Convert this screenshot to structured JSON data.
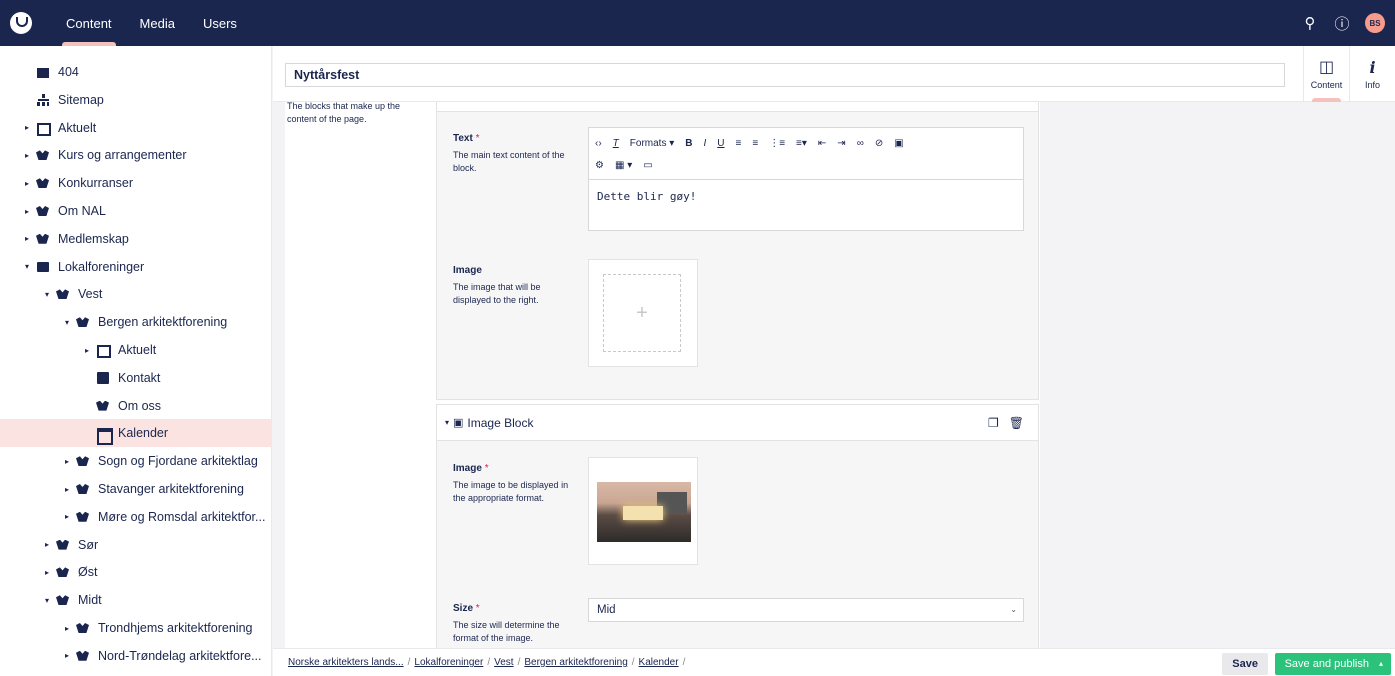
{
  "nav": {
    "content": "Content",
    "media": "Media",
    "users": "Users"
  },
  "user": {
    "initials": "BS"
  },
  "tree": [
    {
      "label": "404",
      "icon": "box",
      "caret": "",
      "indent": 0
    },
    {
      "label": "Sitemap",
      "icon": "sitemap",
      "caret": "",
      "indent": 0
    },
    {
      "label": "Aktuelt",
      "icon": "news",
      "caret": "▸",
      "indent": 0
    },
    {
      "label": "Kurs og arrangementer",
      "icon": "org",
      "caret": "▸",
      "indent": 0
    },
    {
      "label": "Konkurranser",
      "icon": "org",
      "caret": "▸",
      "indent": 0
    },
    {
      "label": "Om NAL",
      "icon": "org",
      "caret": "▸",
      "indent": 0
    },
    {
      "label": "Medlemskap",
      "icon": "org",
      "caret": "▸",
      "indent": 0
    },
    {
      "label": "Lokalforeninger",
      "icon": "folder",
      "caret": "▾",
      "indent": 0
    },
    {
      "label": "Vest",
      "icon": "org",
      "caret": "▾",
      "indent": 1
    },
    {
      "label": "Bergen arkitektforening",
      "icon": "org",
      "caret": "▾",
      "indent": 2
    },
    {
      "label": "Aktuelt",
      "icon": "news",
      "caret": "▸",
      "indent": 3
    },
    {
      "label": "Kontakt",
      "icon": "contact",
      "caret": "",
      "indent": 3
    },
    {
      "label": "Om oss",
      "icon": "org",
      "caret": "",
      "indent": 3
    },
    {
      "label": "Kalender",
      "icon": "calendar",
      "caret": "",
      "indent": 3,
      "active": true
    },
    {
      "label": "Sogn og Fjordane arkitektlag",
      "icon": "org",
      "caret": "▸",
      "indent": 2
    },
    {
      "label": "Stavanger arkitektforening",
      "icon": "org",
      "caret": "▸",
      "indent": 2
    },
    {
      "label": "Møre og Romsdal arkitektfor...",
      "icon": "org",
      "caret": "▸",
      "indent": 2
    },
    {
      "label": "Sør",
      "icon": "org",
      "caret": "▸",
      "indent": 1
    },
    {
      "label": "Øst",
      "icon": "org",
      "caret": "▸",
      "indent": 1
    },
    {
      "label": "Midt",
      "icon": "org",
      "caret": "▾",
      "indent": 1
    },
    {
      "label": "Trondhjems arkitektforening",
      "icon": "org",
      "caret": "▸",
      "indent": 2
    },
    {
      "label": "Nord-Trøndelag arkitektfore...",
      "icon": "org",
      "caret": "▸",
      "indent": 2
    }
  ],
  "page": {
    "name": "Nyttårsfest"
  },
  "apps": {
    "content": "Content",
    "info": "Info"
  },
  "blocks_property": {
    "description": "The blocks that make up the content of the page."
  },
  "text_block": {
    "text_label": "Text",
    "text_desc": "The main text content of the block.",
    "formats": "Formats",
    "body": "Dette blir gøy!",
    "image_label": "Image",
    "image_desc": "The image that will be displayed to the right."
  },
  "image_block": {
    "title": "Image Block",
    "image_label": "Image",
    "image_desc": "The image to be displayed in the appropriate format.",
    "size_label": "Size",
    "size_desc": "The size will determine the format of the image.",
    "size_value": "Mid"
  },
  "required_mark": "*",
  "breadcrumb": [
    "Norske arkitekters lands...",
    "Lokalforeninger",
    "Vest",
    "Bergen arkitektforening",
    "Kalender"
  ],
  "buttons": {
    "save": "Save",
    "publish": "Save and publish"
  }
}
